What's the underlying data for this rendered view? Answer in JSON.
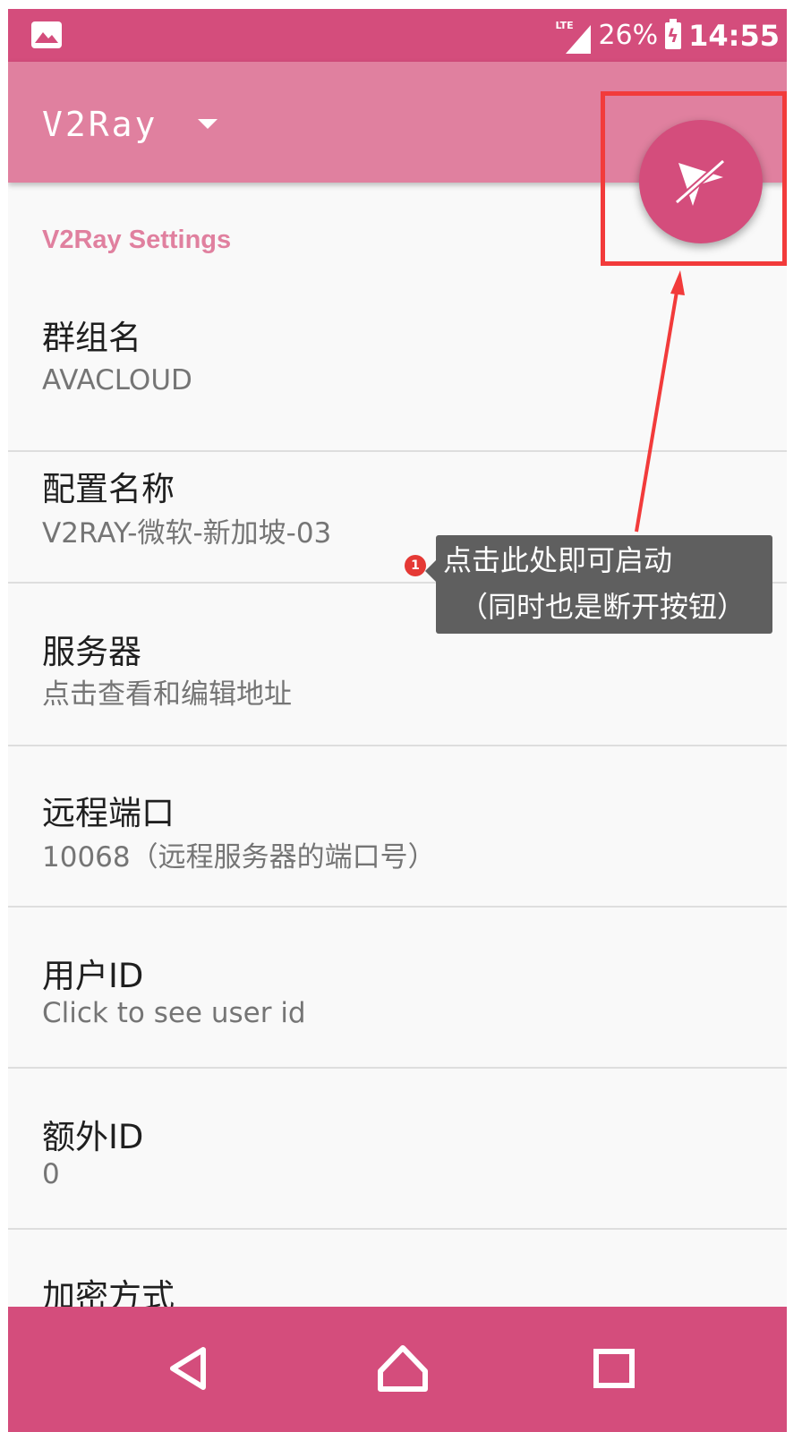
{
  "status_bar": {
    "network": "LTE",
    "battery": "26%",
    "time": "14:55"
  },
  "toolbar": {
    "title": "V2Ray"
  },
  "settings": {
    "section_header": "V2Ray Settings",
    "items": [
      {
        "title": "群组名",
        "summary": "AVACLOUD"
      },
      {
        "title": "配置名称",
        "summary": "V2RAY-微软-新加坡-03"
      },
      {
        "title": "服务器",
        "summary": "点击查看和编辑地址"
      },
      {
        "title": "远程端口",
        "summary": "10068（远程服务器的端口号）"
      },
      {
        "title": "用户ID",
        "summary": "Click to see user id"
      },
      {
        "title": "额外ID",
        "summary": "0"
      },
      {
        "title": "加密方式",
        "summary": ""
      }
    ]
  },
  "tooltip": {
    "badge": "1",
    "line1": "点击此处即可启动",
    "line2": "（同时也是断开按钮）"
  },
  "icons": {
    "fab": "paper-plane-off-icon",
    "nav": [
      "back-icon",
      "home-icon",
      "recents-icon"
    ]
  },
  "colors": {
    "primary": "#d44d7c",
    "toolbar": "#e0809f",
    "highlight": "#f23b3b"
  }
}
